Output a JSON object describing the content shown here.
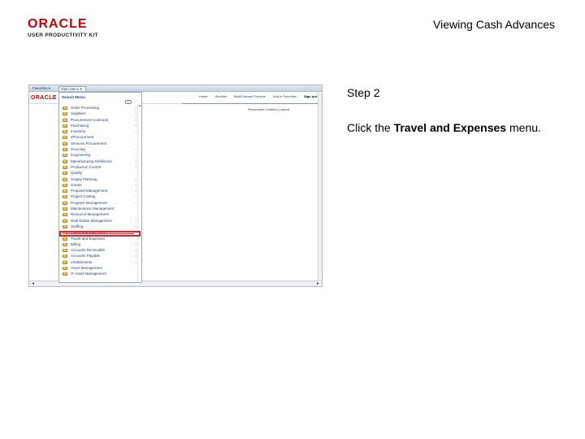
{
  "brand": {
    "logo_word": "ORACLE",
    "logo_sub": "USER PRODUCTIVITY KIT",
    "accent_color": "#cc0000"
  },
  "page": {
    "title": "Viewing Cash Advances"
  },
  "step": {
    "number_label": "Step 2",
    "instruction_prefix": "Click the ",
    "instruction_target": "Travel and Expenses",
    "instruction_suffix": " menu.",
    "highlight_color": "#d3282e"
  },
  "screenshot": {
    "nav": {
      "favorites_label": "Favorites ▾",
      "main_menu_label": "Main Menu ▾"
    },
    "app_logo": "ORACLE",
    "header_links": [
      {
        "label": "Home"
      },
      {
        "label": "Worklist"
      },
      {
        "label": "MultiChannel Console"
      },
      {
        "label": "Add to Favorites"
      },
      {
        "label": "Sign out",
        "signout": true
      }
    ],
    "personalize": "Personalize Content  |  Layout",
    "menu": {
      "search_label": "Search Menu:",
      "search_go": "»",
      "scroll_up": "▲",
      "scroll_down": "▼",
      "items": [
        {
          "label": "Order Processing",
          "has_sub": true
        },
        {
          "label": "Suppliers",
          "has_sub": true
        },
        {
          "label": "Procurement Contracts",
          "has_sub": true
        },
        {
          "label": "Purchasing",
          "has_sub": true
        },
        {
          "label": "Inventory",
          "has_sub": true
        },
        {
          "label": "eProcurement",
          "has_sub": false
        },
        {
          "label": "Services Procurement",
          "has_sub": false
        },
        {
          "label": "Sourcing",
          "has_sub": true
        },
        {
          "label": "Engineering",
          "has_sub": true
        },
        {
          "label": "Manufacturing Definitions",
          "has_sub": true
        },
        {
          "label": "Production Control",
          "has_sub": true
        },
        {
          "label": "Quality",
          "has_sub": false
        },
        {
          "label": "Supply Planning",
          "has_sub": true
        },
        {
          "label": "Grants",
          "has_sub": true
        },
        {
          "label": "Proposal Management",
          "has_sub": true
        },
        {
          "label": "Project Costing",
          "has_sub": true
        },
        {
          "label": "Program Management",
          "has_sub": true
        },
        {
          "label": "Maintenance Management",
          "has_sub": false
        },
        {
          "label": "Resource Management",
          "has_sub": false
        },
        {
          "label": "Real Estate Management",
          "has_sub": true
        },
        {
          "label": "Staffing",
          "has_sub": true
        },
        {
          "label": "Travel and Expenses",
          "has_sub": true,
          "highlight": true
        },
        {
          "label": "Travel and Expenses",
          "has_sub": false
        },
        {
          "label": "Billing",
          "has_sub": true
        },
        {
          "label": "Accounts Receivable",
          "has_sub": true
        },
        {
          "label": "Accounts Payable",
          "has_sub": true
        },
        {
          "label": "eSettlements",
          "has_sub": true
        },
        {
          "label": "Asset Management",
          "has_sub": false
        },
        {
          "label": "IT Asset Management",
          "has_sub": false
        }
      ]
    },
    "hscroll_left": "◄",
    "hscroll_right": "►"
  }
}
